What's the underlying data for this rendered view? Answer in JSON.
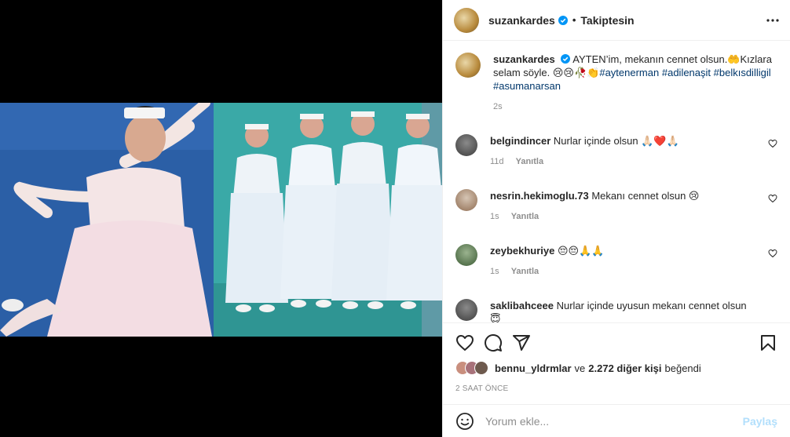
{
  "colors": {
    "accent": "#0095f6",
    "post_disabled": "#b2dffc",
    "hashtag": "#00376b",
    "muted": "#8e8e8e"
  },
  "header": {
    "username": "suzankardes",
    "follow_status": "Takiptesin",
    "separator": "•"
  },
  "caption": {
    "username": "suzankardes",
    "text": "AYTEN’im, mekanın cennet olsun.🤲Kızlara selam söyle. 😢😢🥀👏",
    "hashtags": [
      "#aytenerman",
      "#adilenaşit",
      "#belkısdilligil",
      "#asumanarsan"
    ],
    "time": "2s"
  },
  "comments": [
    {
      "username": "belgindincer",
      "text": "Nurlar içinde olsun 🙏🏻❤️🙏🏻",
      "time": "11d",
      "reply": "Yanıtla"
    },
    {
      "username": "nesrin.hekimoglu.73",
      "text": "Mekanı cennet olsun 😢",
      "time": "1s",
      "reply": "Yanıtla"
    },
    {
      "username": "zeybekhuriye",
      "text": "😔😔🙏🙏",
      "time": "1s",
      "reply": "Yanıtla"
    },
    {
      "username": "saklibahceee",
      "text": "Nurlar içinde uyusun mekanı cennet olsun😇",
      "time": "",
      "reply": ""
    }
  ],
  "icons": [
    "heart-icon",
    "comment-icon",
    "share-icon",
    "bookmark-icon",
    "emoji-icon",
    "more-icon",
    "verified-icon"
  ],
  "likes": {
    "user": "bennu_yldrmlar",
    "connector": "ve",
    "count": "2.272 diğer kişi",
    "suffix": "beğendi"
  },
  "post_time": "2 SAAT ÖNCE",
  "add_comment": {
    "placeholder": "Yorum ekle...",
    "post_label": "Paylaş"
  }
}
